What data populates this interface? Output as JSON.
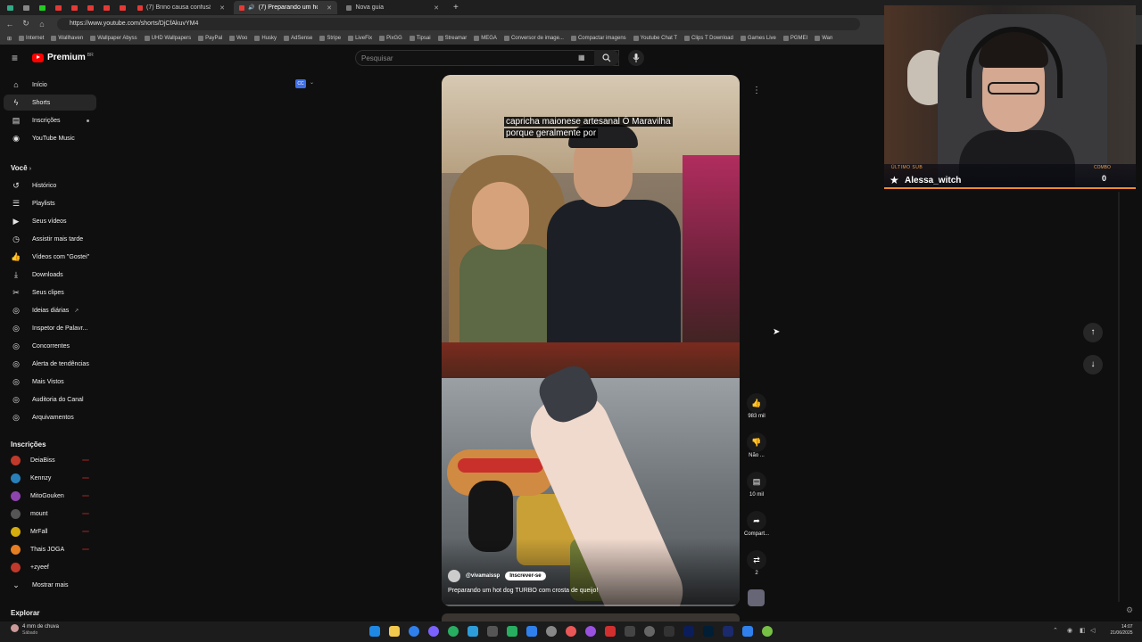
{
  "browser": {
    "tabs": [
      {
        "label": "(7) Brino causa confusão no Rodi..."
      },
      {
        "label": "(7) Preparando um hot dog..."
      },
      {
        "label": "Nova guia"
      }
    ],
    "new_tab": "+",
    "url": "https://www.youtube.com/shorts/DjCfAkuvYM4",
    "bookmarks": [
      "Internet",
      "Wallhaven",
      "Wallpaper Abyss",
      "UHD Wallpapers",
      "PayPal",
      "Woo",
      "Husky",
      "AdSense",
      "Stripe",
      "LiveFix",
      "PixGG",
      "Tipsai",
      "Streamar",
      "MEGA",
      "Conversor de image...",
      "Compactar imagens",
      "Youtube Chat T",
      "Clips T Download",
      "Games Live",
      "PGMEI",
      "Wan"
    ]
  },
  "header": {
    "logo_text": "Premium",
    "country": "BR",
    "search_placeholder": "Pesquisar"
  },
  "sidebar": {
    "top": [
      {
        "label": "Início",
        "icon": "home-icon"
      },
      {
        "label": "Shorts",
        "icon": "shorts-icon"
      },
      {
        "label": "Inscrições",
        "icon": "subscriptions-icon"
      },
      {
        "label": "YouTube Music",
        "icon": "music-icon"
      }
    ],
    "you_heading": "Você",
    "you": [
      {
        "label": "Histórico"
      },
      {
        "label": "Playlists"
      },
      {
        "label": "Seus vídeos"
      },
      {
        "label": "Assistir mais tarde"
      },
      {
        "label": "Vídeos com \"Gostei\""
      },
      {
        "label": "Downloads"
      },
      {
        "label": "Seus clipes"
      },
      {
        "label": "Ideias diárias"
      },
      {
        "label": "Inspetor de Palavr..."
      },
      {
        "label": "Concorrentes"
      },
      {
        "label": "Alerta de tendências"
      },
      {
        "label": "Mais Vistos"
      },
      {
        "label": "Auditoria do Canal"
      },
      {
        "label": "Arquivamentos"
      }
    ],
    "subs_heading": "Inscrições",
    "subs": [
      {
        "label": "DeiaBiss",
        "color": "#c0392b"
      },
      {
        "label": "Kennzy",
        "color": "#2980b9"
      },
      {
        "label": "MitoGouken",
        "color": "#8e44ad"
      },
      {
        "label": "mount",
        "color": "#555555"
      },
      {
        "label": "MrFall",
        "color": "#d4ac0d"
      },
      {
        "label": "Thais JOGA",
        "color": "#e67e22"
      },
      {
        "label": "+zyeef",
        "color": "#c0392b"
      }
    ],
    "show_more": "Mostrar mais",
    "explore_heading": "Explorar"
  },
  "short": {
    "caption_line1": "capricha maionese artesanal Ó Maravilha",
    "caption_line2": "porque geralmente por",
    "channel": "@vivamaissp",
    "subscribe": "Inscrever-se",
    "title": "Preparando um hot dog TURBO com crosta de queijo!",
    "likes": "983 mil",
    "dislike": "Não ...",
    "comments": "10 mil",
    "share": "Compart...",
    "remix": "2"
  },
  "overlay": {
    "last_sub_tag": "ÚLTIMO SUB",
    "last_sub_name": "Alessa_witch",
    "combo_tag": "COMBO",
    "combo_value": "0"
  },
  "taskbar": {
    "weather": "4 mm de chuva",
    "day": "Sábado",
    "time": "14:07",
    "date": "21/06/2025"
  },
  "colors": {
    "youtube_red": "#ff0000",
    "background": "#0f0f0f",
    "accent_orange": "#f08a2c"
  }
}
